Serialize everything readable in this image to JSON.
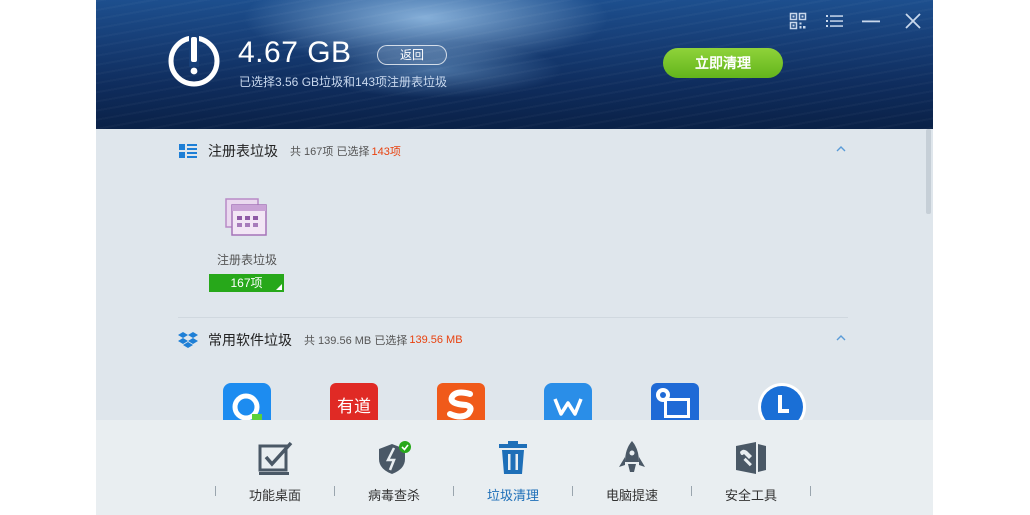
{
  "header": {
    "size_value": "4.67 GB",
    "back_label": "返回",
    "summary": "已选择3.56 GB垃圾和143项注册表垃圾",
    "clean_label": "立即清理"
  },
  "window_controls": [
    "qr-code-icon",
    "menu-icon",
    "minimize-icon",
    "close-icon"
  ],
  "sections": [
    {
      "title": "注册表垃圾",
      "count_text": "共 167项 已选择",
      "highlight": "143项",
      "icon": "registry-grid-icon"
    },
    {
      "title": "常用软件垃圾",
      "count_text": "共 139.56 MB 已选择",
      "highlight": "139.56 MB",
      "icon": "dropbox-icon"
    }
  ],
  "registry_tile": {
    "label": "注册表垃圾",
    "badge": "167项"
  },
  "software_icons": [
    "qq-browser-icon",
    "youdao-icon",
    "sogou-icon",
    "wps-icon",
    "settings-app-icon",
    "l-app-icon"
  ],
  "nav": {
    "items": [
      {
        "label": "功能桌面",
        "icon": "checkbox-icon"
      },
      {
        "label": "病毒查杀",
        "icon": "shield-bolt-icon"
      },
      {
        "label": "垃圾清理",
        "icon": "trash-icon"
      },
      {
        "label": "电脑提速",
        "icon": "rocket-icon"
      },
      {
        "label": "安全工具",
        "icon": "wrench-tool-icon"
      }
    ]
  },
  "colors": {
    "accent_green": "#63b51c",
    "highlight_red": "#e8420f",
    "badge_green": "#27a81a",
    "active_blue": "#1e6fb8"
  }
}
